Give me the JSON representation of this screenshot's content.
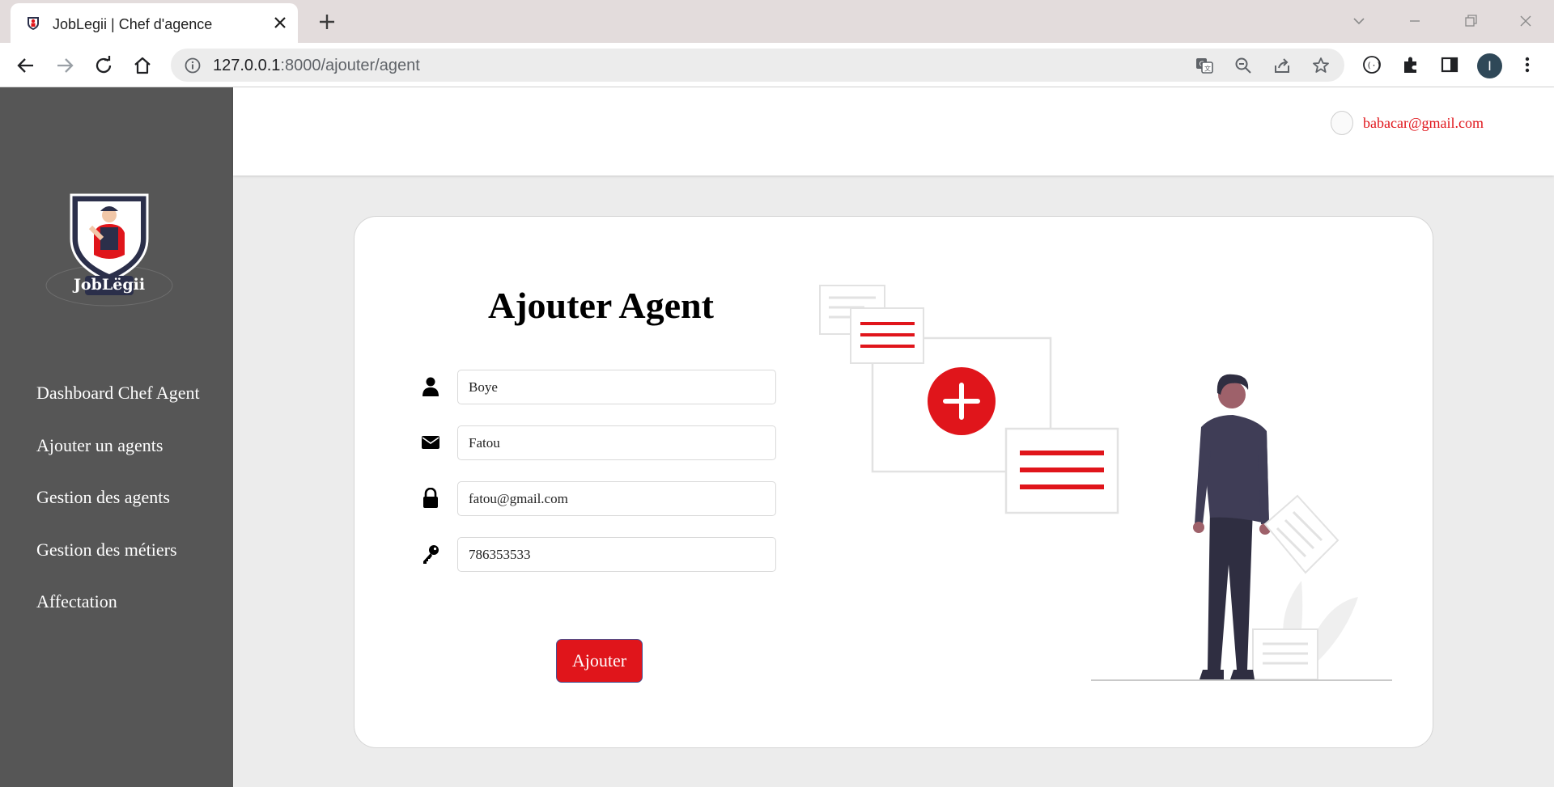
{
  "browser": {
    "tab_title": "JobLegii | Chef d'agence",
    "url_host": "127.0.0.1",
    "url_path": ":8000/ajouter/agent",
    "profile_initial": "I"
  },
  "sidebar": {
    "logo_text": "JobLëgii",
    "items": [
      {
        "label": "Dashboard Chef Agent"
      },
      {
        "label": "Ajouter un agents"
      },
      {
        "label": "Gestion des agents"
      },
      {
        "label": "Gestion des métiers"
      },
      {
        "label": "Affectation"
      }
    ]
  },
  "header": {
    "user_email": "babacar@gmail.com"
  },
  "form": {
    "title": "Ajouter Agent",
    "fields": [
      {
        "icon": "user-icon",
        "value": "Boye"
      },
      {
        "icon": "envelope-icon",
        "value": "Fatou"
      },
      {
        "icon": "lock-icon",
        "value": "fatou@gmail.com"
      },
      {
        "icon": "key-icon",
        "value": "786353533"
      }
    ],
    "submit_label": "Ajouter"
  },
  "colors": {
    "accent": "#e0151b",
    "sidebar": "#565656",
    "background": "#ececec"
  }
}
